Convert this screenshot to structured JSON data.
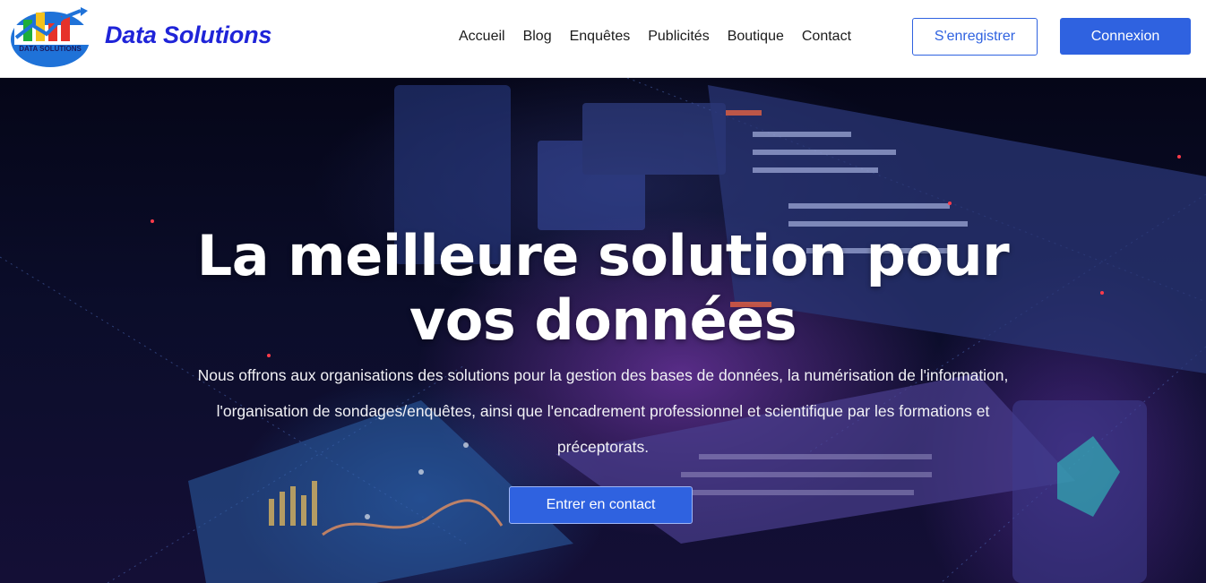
{
  "header": {
    "logo_text": "DATA SOLUTIONS",
    "brand": "Data Solutions",
    "nav": [
      "Accueil",
      "Blog",
      "Enquêtes",
      "Publicités",
      "Boutique",
      "Contact"
    ],
    "register_label": "S'enregistrer",
    "login_label": "Connexion"
  },
  "hero": {
    "title_line1": "La meilleure solution pour",
    "title_line2": "vos données",
    "description_lines": [
      "Nous offrons aux organisations des solutions pour la gestion des bases de données, la numérisation de l'information,",
      "l'organisation de sondages/enquêtes, ainsi que l'encadrement professionnel et scientifique par les formations et",
      "préceptorats."
    ],
    "cta_label": "Entrer en contact"
  },
  "colors": {
    "brand_blue": "#1f24d8",
    "button_blue": "#2f62e0"
  }
}
